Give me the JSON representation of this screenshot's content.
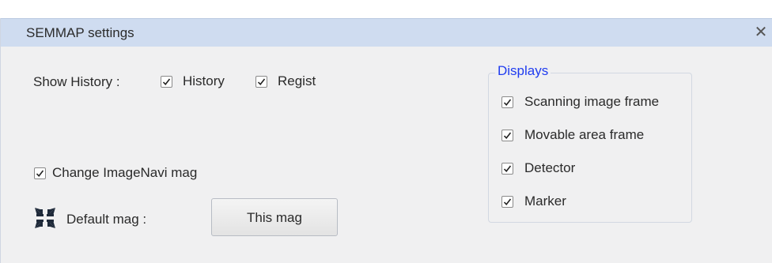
{
  "window": {
    "title": "SEMMAP settings",
    "close_glyph": "✕"
  },
  "history": {
    "label": "Show History :",
    "options": [
      {
        "label": "History",
        "checked": true
      },
      {
        "label": "Regist",
        "checked": true
      }
    ]
  },
  "change_imagenavi": {
    "label": "Change ImageNavi mag",
    "checked": true
  },
  "default_mag": {
    "label": "Default mag :",
    "icon": "collapse-arrows-icon",
    "button_label": "This mag"
  },
  "displays": {
    "legend": "Displays",
    "items": [
      {
        "label": "Scanning image frame",
        "checked": true
      },
      {
        "label": "Movable area frame",
        "checked": true
      },
      {
        "label": "Detector",
        "checked": true
      },
      {
        "label": "Marker",
        "checked": true
      }
    ]
  },
  "colors": {
    "titlebar": "#cfdcf0",
    "legend_text": "#1f3cf0",
    "icon": "#1f2a3a"
  }
}
